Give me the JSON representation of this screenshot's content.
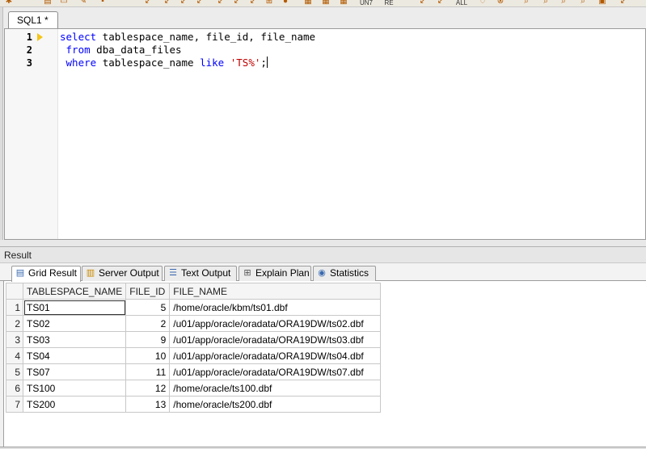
{
  "editor": {
    "tab_label": "SQL1 *",
    "line_numbers": [
      "1",
      "2",
      "3"
    ],
    "lines": [
      [
        {
          "t": "select",
          "c": "kw"
        },
        {
          "t": " tablespace_name, file_id, file_name",
          "c": ""
        }
      ],
      [
        {
          "t": " ",
          "c": ""
        },
        {
          "t": "from",
          "c": "kw"
        },
        {
          "t": " dba_data_files",
          "c": ""
        }
      ],
      [
        {
          "t": " ",
          "c": ""
        },
        {
          "t": "where",
          "c": "kw"
        },
        {
          "t": " tablespace_name ",
          "c": ""
        },
        {
          "t": "like",
          "c": "kw"
        },
        {
          "t": " ",
          "c": ""
        },
        {
          "t": "'TS%'",
          "c": "str"
        },
        {
          "t": ";",
          "c": ""
        }
      ]
    ]
  },
  "toolbar": {
    "labels": [
      "UN7",
      "RE",
      "ALL"
    ]
  },
  "result": {
    "header": "Result",
    "tabs": [
      {
        "label": "Grid Result",
        "icon": "grid-icon"
      },
      {
        "label": "Server Output",
        "icon": "database-icon"
      },
      {
        "label": "Text Output",
        "icon": "text-icon"
      },
      {
        "label": "Explain Plan",
        "icon": "plan-icon"
      },
      {
        "label": "Statistics",
        "icon": "sql-stats-icon"
      }
    ],
    "columns": [
      "TABLESPACE_NAME",
      "FILE_ID",
      "FILE_NAME"
    ],
    "rows": [
      [
        "1",
        "TS01",
        "5",
        "/home/oracle/kbm/ts01.dbf"
      ],
      [
        "2",
        "TS02",
        "2",
        "/u01/app/oracle/oradata/ORA19DW/ts02.dbf"
      ],
      [
        "3",
        "TS03",
        "9",
        "/u01/app/oracle/oradata/ORA19DW/ts03.dbf"
      ],
      [
        "4",
        "TS04",
        "10",
        "/u01/app/oracle/oradata/ORA19DW/ts04.dbf"
      ],
      [
        "5",
        "TS07",
        "11",
        "/u01/app/oracle/oradata/ORA19DW/ts07.dbf"
      ],
      [
        "6",
        "TS100",
        "12",
        "/home/oracle/ts100.dbf"
      ],
      [
        "7",
        "TS200",
        "13",
        "/home/oracle/ts200.dbf"
      ]
    ]
  }
}
